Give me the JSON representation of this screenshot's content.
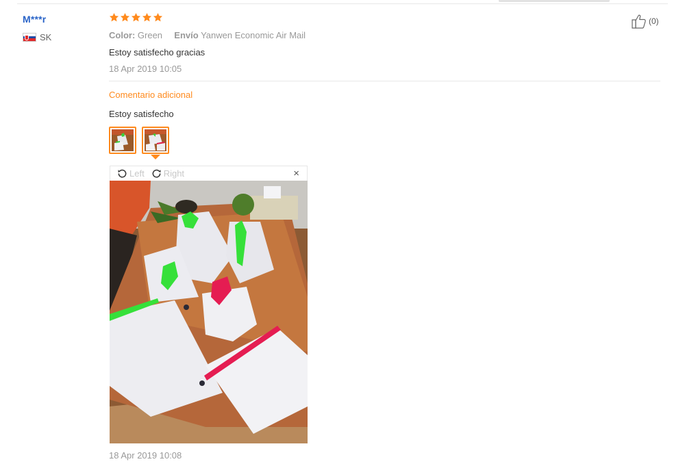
{
  "review": {
    "user_name": "M***r",
    "country": "SK",
    "rating": 5,
    "color_label": "Color:",
    "color_value": "Green",
    "shipping_label": "Envío",
    "shipping_value": "Yanwen Economic Air Mail",
    "text": "Estoy satisfecho gracias",
    "date": "18 Apr 2019 10:05",
    "likes": "(0)"
  },
  "additional": {
    "title": "Comentario adicional",
    "text": "Estoy satisfecho",
    "date": "18 Apr 2019 10:08"
  },
  "viewer": {
    "rotate_left_label": "Left",
    "rotate_right_label": "Right",
    "close_glyph": "×"
  },
  "icons": {
    "star": "star-icon",
    "like": "thumbs-up-icon",
    "flag": "slovakia-flag-icon",
    "rotate_left": "rotate-left-icon",
    "rotate_right": "rotate-right-icon",
    "close": "close-icon"
  },
  "colors": {
    "accent": "#ff8a1d",
    "username": "#2a64c8",
    "star": "#ff8a1d",
    "muted_text": "#999999"
  }
}
